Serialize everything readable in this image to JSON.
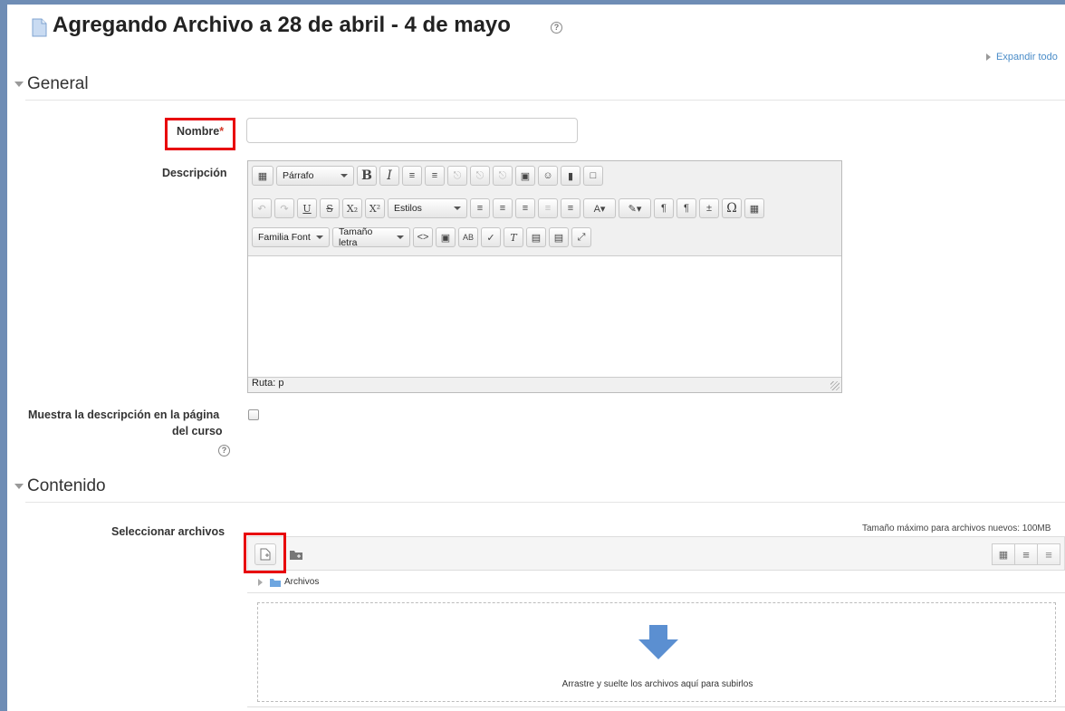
{
  "header": {
    "title": "Agregando Archivo a 28 de abril - 4 de mayo",
    "expand_all": "Expandir todo"
  },
  "sections": {
    "general": "General",
    "content": "Contenido"
  },
  "form": {
    "name_label": "Nombre",
    "name_required_mark": "*",
    "name_value": "",
    "description_label": "Descripción",
    "show_description_label_line1": "Muestra la descripción en la página",
    "show_description_label_line2": "del curso",
    "show_description_checked": false,
    "select_files_label": "Seleccionar archivos"
  },
  "editor": {
    "paragraph_select": "Párrafo",
    "styles_select": "Estilos",
    "font_family_select": "Familia Font",
    "font_size_select": "Tamaño letra",
    "status_path": "Ruta: p",
    "content": ""
  },
  "filepicker": {
    "max_size": "Tamaño máximo para archivos nuevos: 100MB",
    "path_root": "Archivos",
    "drop_hint": "Arrastre y suelte los archivos aquí para subirlos"
  },
  "colors": {
    "highlight": "#e8000a",
    "link": "#4a8cc8",
    "frame": "#6f8db5",
    "drop_arrow": "#5b8fd1"
  }
}
